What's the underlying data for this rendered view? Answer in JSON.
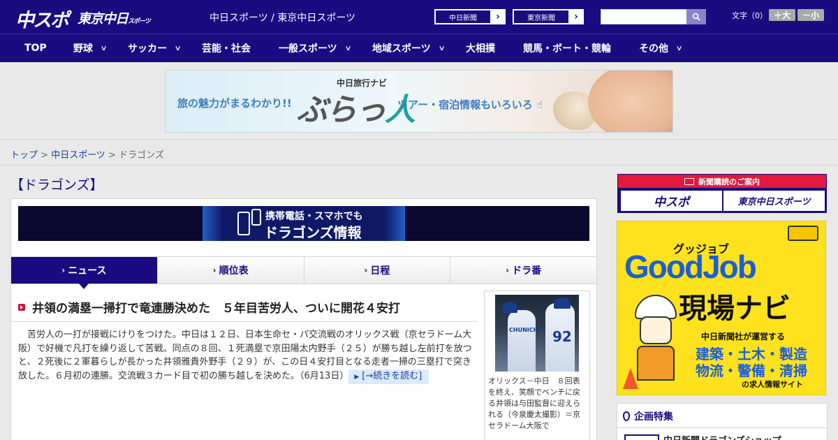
{
  "header": {
    "logo_main": "中スポ",
    "logo_tokyo": "東京中日",
    "logo_tokyo_suffix": "スポーツ",
    "site_title": "中日スポーツ / 東京中日スポーツ",
    "paper_links": [
      {
        "label": "中日新聞"
      },
      {
        "label": "東京新聞"
      }
    ],
    "search_placeholder": "",
    "font_label": "文字（0）",
    "font_bigger": "＋大",
    "font_smaller": "－小"
  },
  "nav": {
    "items": [
      {
        "label": "TOP",
        "has_dropdown": false
      },
      {
        "label": "野球",
        "has_dropdown": true
      },
      {
        "label": "サッカー",
        "has_dropdown": true
      },
      {
        "label": "芸能・社会",
        "has_dropdown": false
      },
      {
        "label": "一般スポーツ",
        "has_dropdown": true
      },
      {
        "label": "地域スポーツ",
        "has_dropdown": true
      },
      {
        "label": "大相撲",
        "has_dropdown": false
      },
      {
        "label": "競馬・ボート・競輪",
        "has_dropdown": false
      },
      {
        "label": "その他",
        "has_dropdown": true
      }
    ]
  },
  "ad_banner": {
    "left_text": "旅の魅力がまるわかり!!",
    "sub_text": "中日旅行ナビ",
    "main_text_a": "ぶらっ",
    "main_text_b": "人",
    "right_text": "ツアー・宿泊情報もいろいろ"
  },
  "breadcrumb": {
    "items": [
      {
        "label": "トップ",
        "link": true
      },
      {
        "label": "中日スポーツ",
        "link": true
      },
      {
        "label": "ドラゴンズ",
        "link": false
      }
    ],
    "separator": " > "
  },
  "page": {
    "heading": "【ドラゴンズ】"
  },
  "mobile_banner": {
    "line1": "携帯電話・スマホでも",
    "line2": "ドラゴンズ情報"
  },
  "tabs": [
    {
      "label": "ニュース",
      "active": true
    },
    {
      "label": "順位表",
      "active": false
    },
    {
      "label": "日程",
      "active": false
    },
    {
      "label": "ドラ番",
      "active": false
    }
  ],
  "article": {
    "title": "井領の満塁一掃打で竜連勝決めた　５年目苦労人、ついに開花４安打",
    "body": "苦労人の一打が接戦にけりをつけた。中日は１２日、日本生命セ・パ交流戦のオリックス戦（京セラドーム大阪）で好機で凡打を繰り返して苦戦。同点の８回、１死満塁で京田陽太内野手（２５）が勝ち越し左前打を放つと、２死後に２軍暮らしが長かった井領雅貴外野手（２９）が、この日４安打目となる走者一掃の三塁打で突き放した。６月初の連勝。交流戦３カード目で初の勝ち越しを決めた。（6月13日）",
    "read_more": "[→続きを読む]",
    "photo_jersey": "CHUNICHI",
    "photo_number": "92",
    "photo_caption": "オリックス－中日　８回表を終え、笑顔でベンチに戻る井領は与田監督に迎えられる（今泉慶太撮影）＝京セラドーム大阪で"
  },
  "subscription": {
    "heading": "新聞購読のご案内",
    "buttons": [
      {
        "label": "中スポ"
      },
      {
        "label": "東京中日スポーツ"
      }
    ]
  },
  "goodjob_ad": {
    "small": "グッジョブ",
    "big": "GoodJob",
    "genba": "現場ナビ",
    "line1": "中日新聞社が運営する",
    "line2": "建築・土木・製造",
    "line3": "物流・警備・清掃",
    "line4": "の求人情報サイト"
  },
  "feature": {
    "heading": "企画特集",
    "item": "中日新聞ドラゴンズショップ"
  },
  "colors": {
    "brand_navy": "#1a0b80",
    "accent_red": "#e2183d",
    "link_blue": "#1a3fa0"
  }
}
